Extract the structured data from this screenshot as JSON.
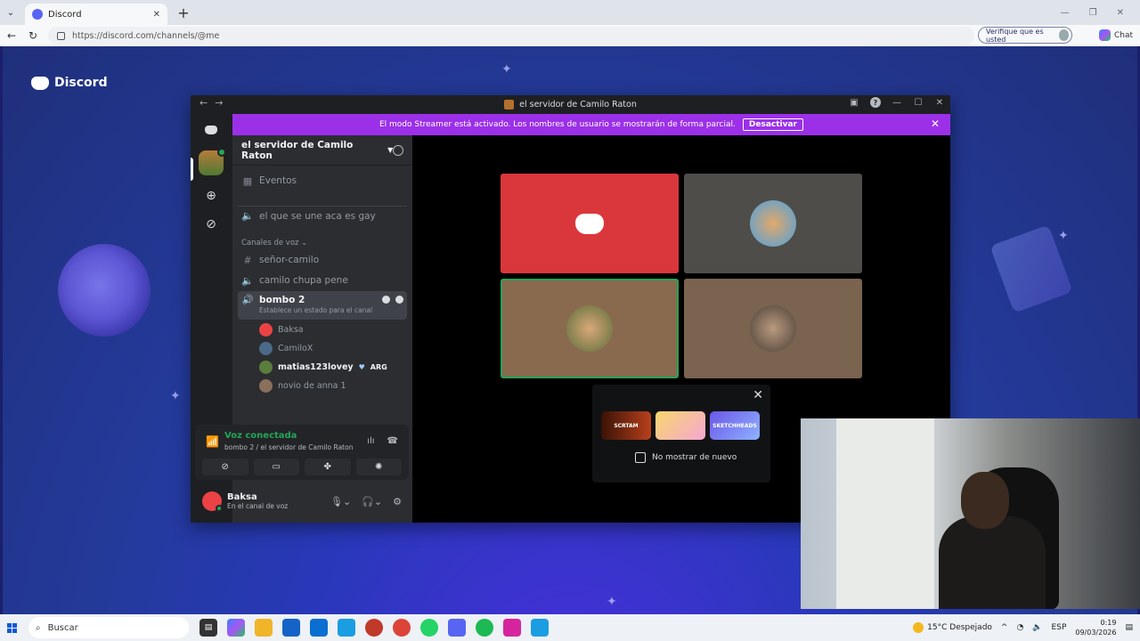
{
  "browser": {
    "tab_title": "Discord",
    "url": "https://discord.com/channels/@me",
    "verify_label": "Verifique que es usted",
    "chat_label": "Chat"
  },
  "page": {
    "brand": "Discord"
  },
  "window": {
    "title": "el servidor de Camilo Raton"
  },
  "banner": {
    "text": "El modo Streamer está activado. Los nombres de usuario se mostrarán de forma parcial.",
    "button": "Desactivar"
  },
  "sidebar": {
    "server_name": "el servidor de Camilo Raton",
    "events": "Eventos",
    "text_channel": "el que se une aca es gay",
    "category": "Canales de voz",
    "channels": [
      "señor-camilo",
      "camilo chupa pene"
    ],
    "active_channel": {
      "name": "bombo 2",
      "status": "Establece un estado para el canal"
    },
    "members": [
      {
        "name": "Baksa",
        "color": "#ed4245"
      },
      {
        "name": "CamiloX",
        "color": "#4b6a8a"
      },
      {
        "name": "matias123lovey",
        "color": "#5c7d3c",
        "tag": "ARG"
      },
      {
        "name": "novio de anna 1",
        "color": "#8a6f5a"
      }
    ]
  },
  "voice": {
    "title": "Voz conectada",
    "subtitle": "bombo 2 / el servidor de Camilo Raton"
  },
  "user": {
    "name": "Baksa",
    "status": "En el canal de voz"
  },
  "activity_popup": {
    "games": [
      "SCRTAM",
      "",
      "SKETCHHEADS"
    ],
    "checkbox": "No mostrar de nuevo"
  },
  "taskbar": {
    "search": "Buscar",
    "weather": "15°C  Despejado",
    "lang": "ESP",
    "time": "0:19",
    "date": "09/03/2026"
  },
  "colors": {
    "blurple": "#5865f2",
    "streamer_banner": "#9b30e8",
    "green": "#23a559",
    "red_tile": "#da373c"
  }
}
